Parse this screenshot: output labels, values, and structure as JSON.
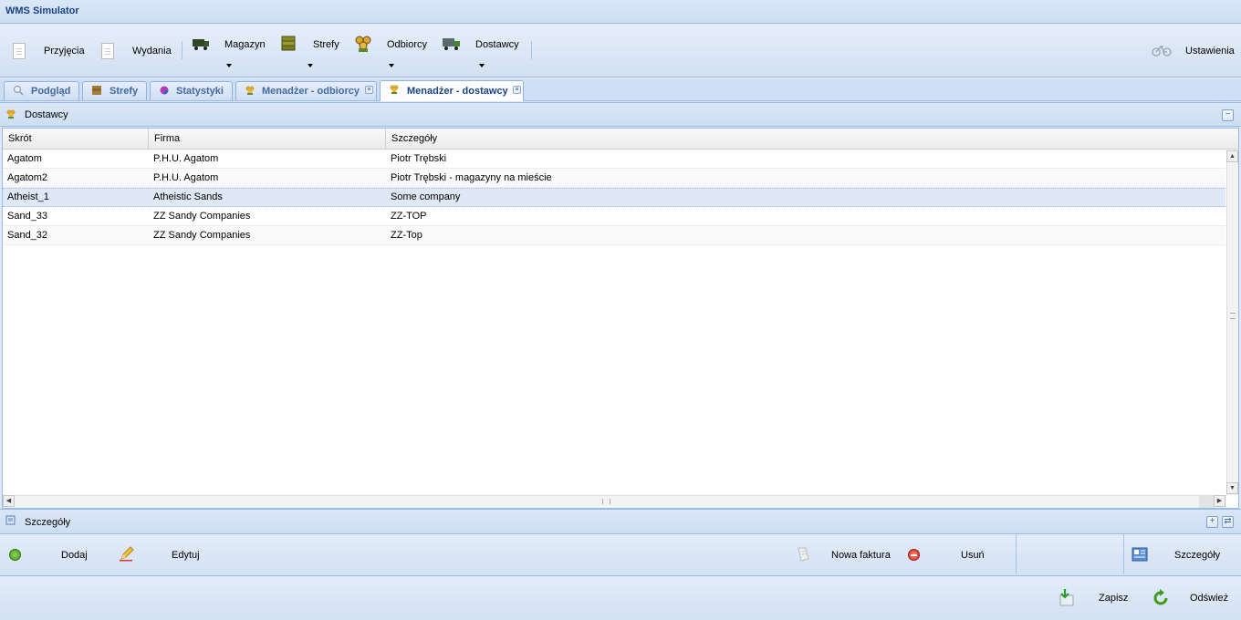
{
  "app": {
    "title": "WMS Simulator"
  },
  "toolbar": {
    "items": [
      {
        "label": "Przyjęcia",
        "icon": "document-icon"
      },
      {
        "label": "Wydania",
        "icon": "document-icon"
      },
      {
        "label": "Magazyn",
        "icon": "truck-icon",
        "has_menu": true
      },
      {
        "label": "Strefy",
        "icon": "boxes-icon",
        "has_menu": true
      },
      {
        "label": "Odbiorcy",
        "icon": "people-icon",
        "has_menu": true
      },
      {
        "label": "Dostawcy",
        "icon": "delivery-truck-icon",
        "has_menu": true
      }
    ],
    "settings_label": "Ustawienia"
  },
  "tabs": [
    {
      "label": "Podgląd",
      "icon": "magnifier-icon",
      "closable": false,
      "active": false
    },
    {
      "label": "Strefy",
      "icon": "boxes-icon",
      "closable": false,
      "active": false
    },
    {
      "label": "Statystyki",
      "icon": "pie-chart-icon",
      "closable": false,
      "active": false
    },
    {
      "label": "Menadżer - odbiorcy",
      "icon": "people-icon",
      "closable": true,
      "active": false
    },
    {
      "label": "Menadżer - dostawcy",
      "icon": "people-icon",
      "closable": true,
      "active": true
    }
  ],
  "suppliers_panel": {
    "title": "Dostawcy",
    "columns": [
      "Skrót",
      "Firma",
      "Szczegóły"
    ],
    "rows": [
      [
        "Agatom",
        "P.H.U. Agatom",
        "Piotr Trębski"
      ],
      [
        "Agatom2",
        "P.H.U. Agatom",
        "Piotr Trębski - magazyny na mieście"
      ],
      [
        "Atheist_1",
        "Atheistic Sands",
        "Some company"
      ],
      [
        "Sand_33",
        "ZZ Sandy Companies",
        "ZZ-TOP"
      ],
      [
        "Sand_32",
        "ZZ Sandy Companies",
        "ZZ-Top"
      ]
    ],
    "selected_row": 2
  },
  "details_panel": {
    "title": "Szczegóły"
  },
  "actions": {
    "add": "Dodaj",
    "edit": "Edytuj",
    "new_invoice": "Nowa faktura",
    "delete": "Usuń",
    "details": "Szczegóły"
  },
  "footer": {
    "save": "Zapisz",
    "refresh": "Odśwież"
  },
  "colors": {
    "header_text": "#15428b",
    "panel_bg": "#dfe8f6",
    "border": "#99bbe8",
    "selected_row": "#dfe8f6"
  }
}
